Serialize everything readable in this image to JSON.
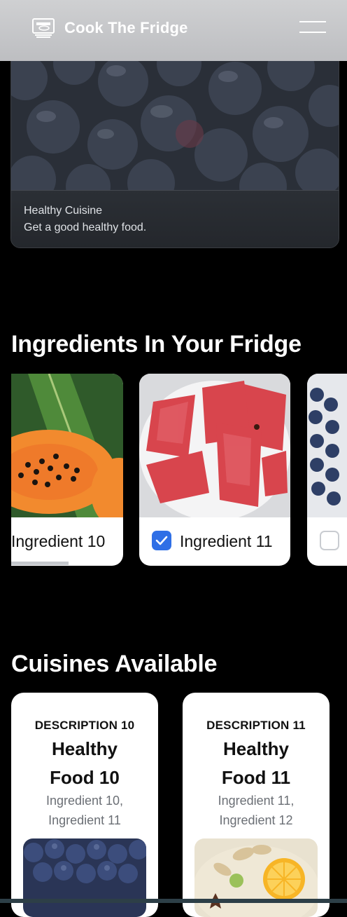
{
  "header": {
    "title": "Cook The Fridge",
    "logo_icon": "chef-logo-icon",
    "menu_icon": "hamburger-menu-icon"
  },
  "hero": {
    "title": "Healthy Cuisine",
    "subtitle": "Get a good healthy food.",
    "image": "blueberries-photo"
  },
  "ingredients_section": {
    "title": "Ingredients In Your Fridge",
    "items": [
      {
        "label": "Ingredient 10",
        "checked": null,
        "image": "papaya-photo"
      },
      {
        "label": "Ingredient 11",
        "checked": true,
        "image": "watermelon-photo"
      },
      {
        "label": "",
        "checked": false,
        "image": "blueberries-photo"
      }
    ]
  },
  "cuisines_section": {
    "title": "Cuisines Available",
    "items": [
      {
        "description": "DESCRIPTION 10",
        "name_line1": "Healthy",
        "name_line2": "Food 10",
        "ingredients_line1": "Ingredient 10,",
        "ingredients_line2": "Ingredient 11",
        "image": "blueberries-photo"
      },
      {
        "description": "DESCRIPTION 11",
        "name_line1": "Healthy",
        "name_line2": "Food 11",
        "ingredients_line1": "Ingredient 11,",
        "ingredients_line2": "Ingredient 12",
        "image": "oatmeal-fruit-bowl-photo"
      }
    ]
  },
  "colors": {
    "background": "#000000",
    "checkbox_checked": "#2f6fe6",
    "card": "#ffffff"
  }
}
